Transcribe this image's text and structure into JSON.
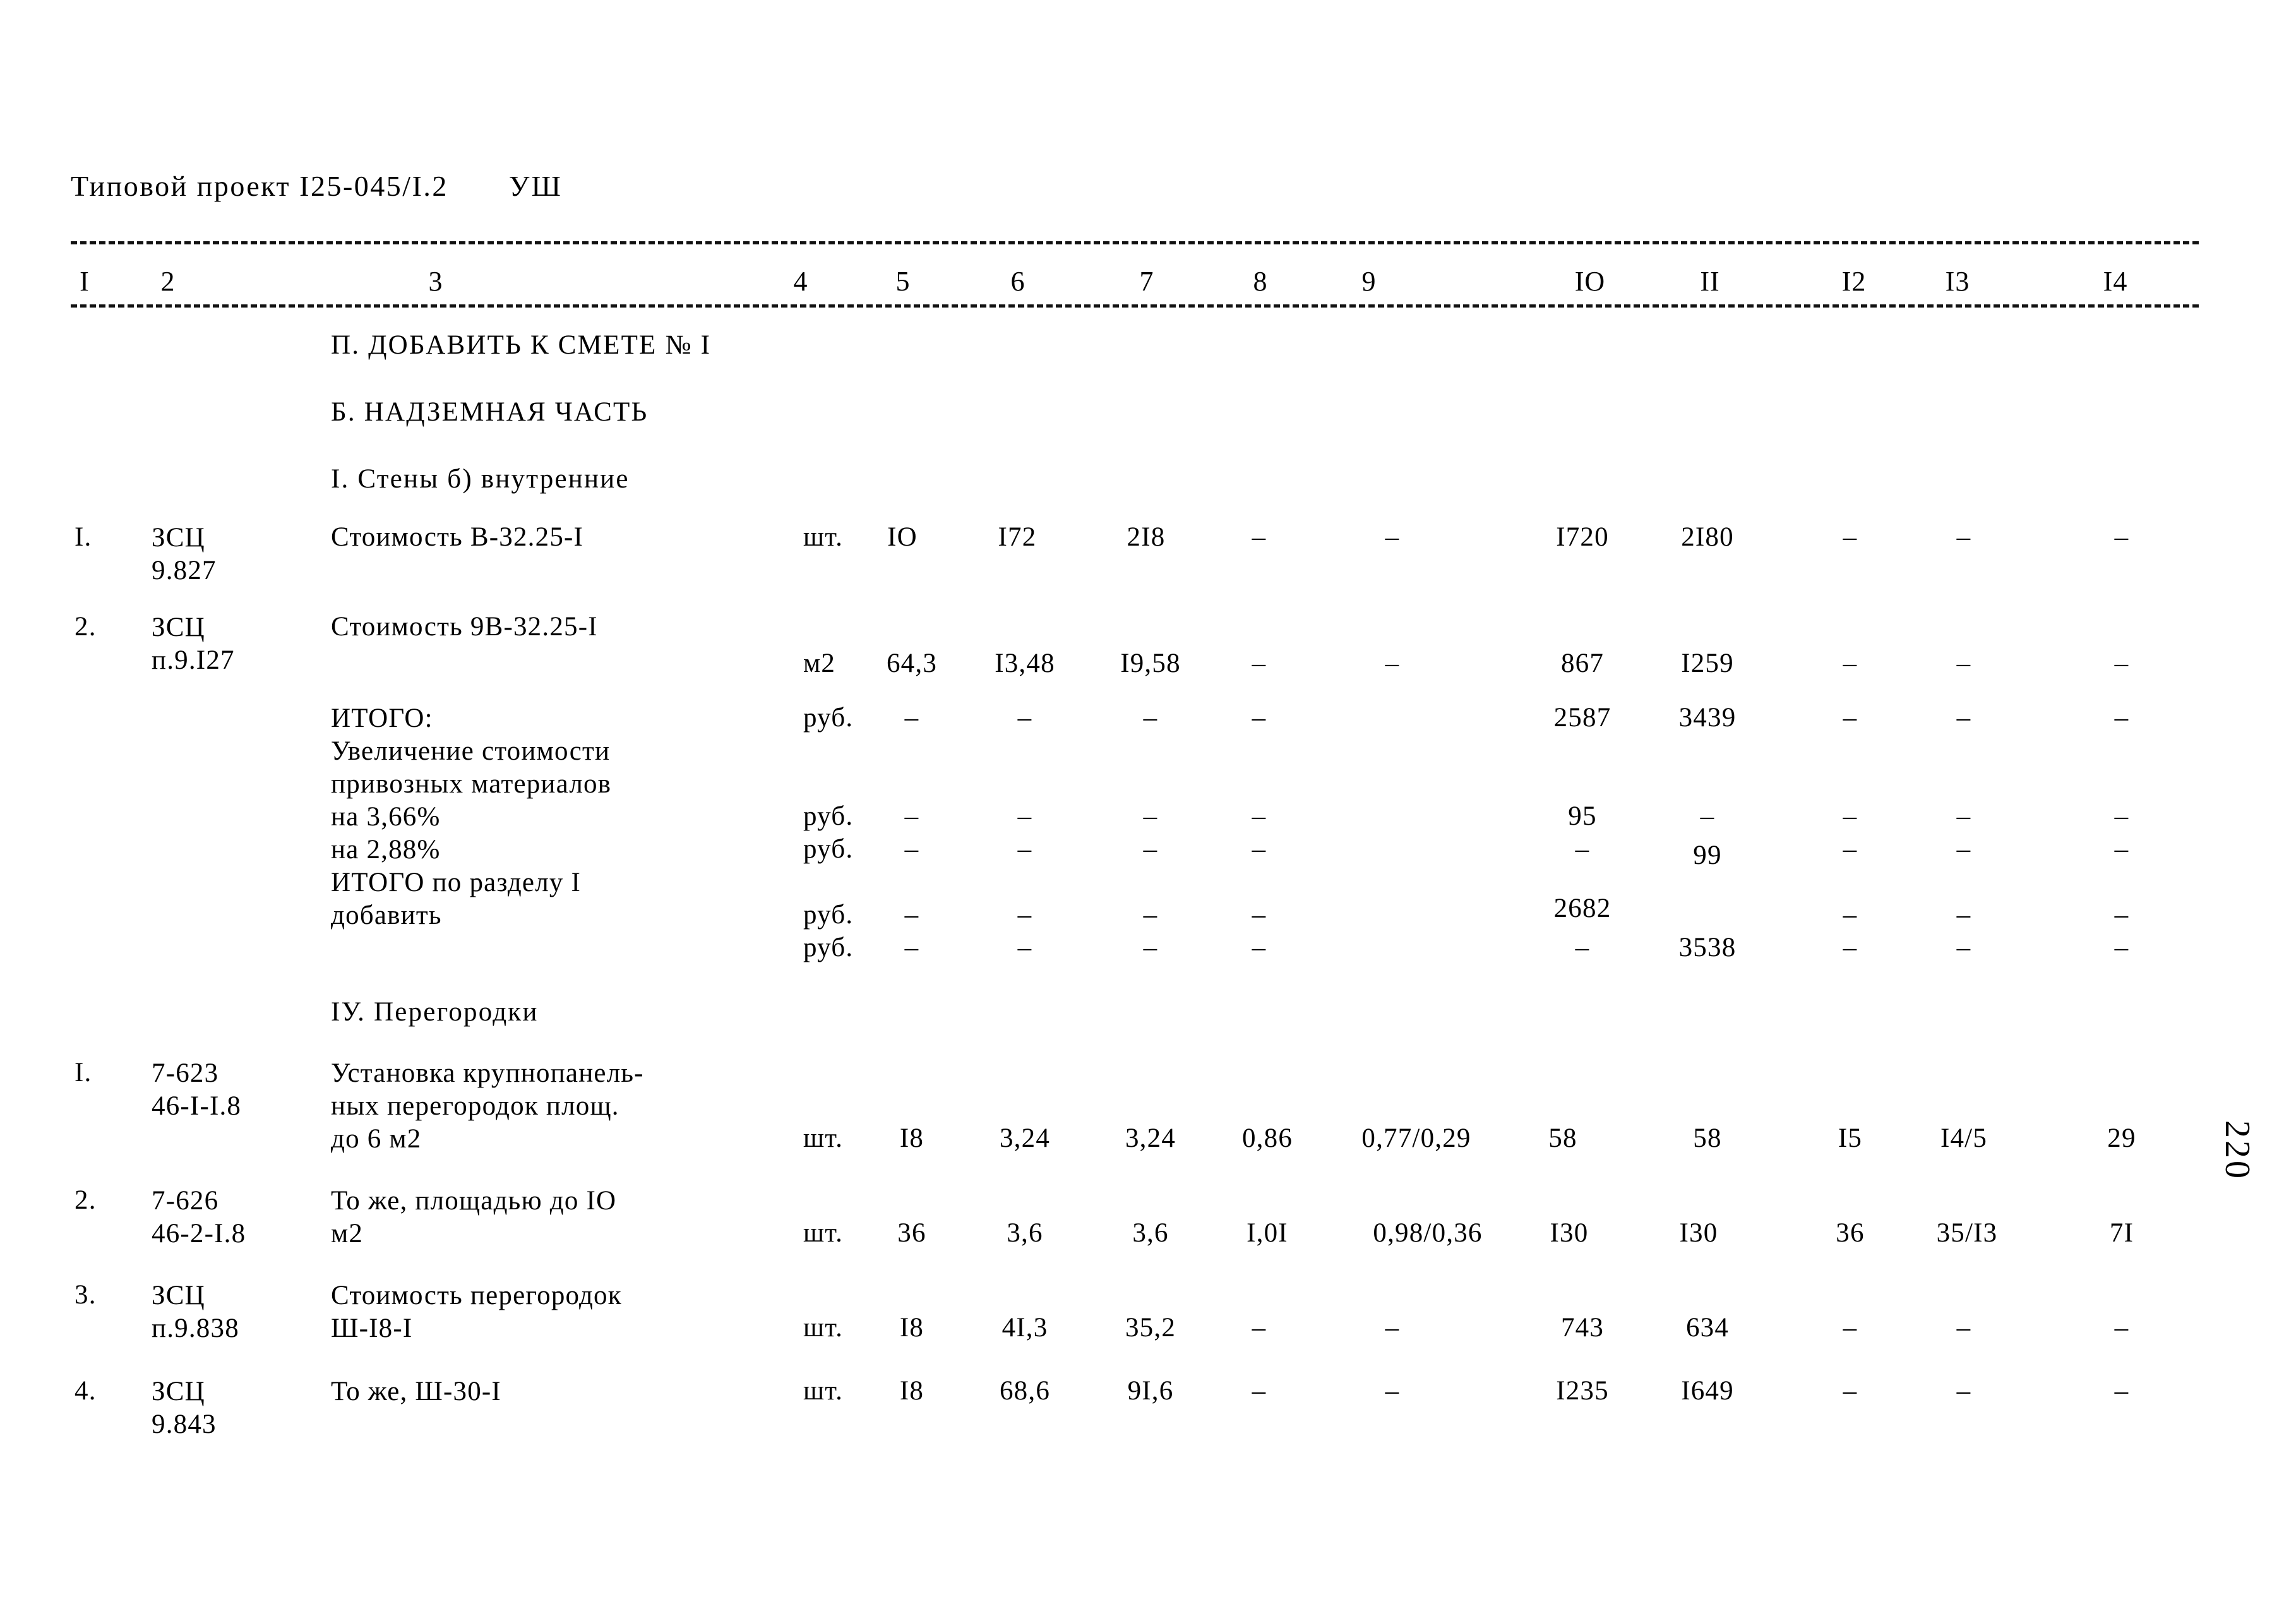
{
  "document": {
    "title_prefix": "Типовой проект",
    "project_code": "I25-045/I.2",
    "sheet_mark": "УШ",
    "folio_number": "220"
  },
  "table": {
    "column_numbers": [
      "I",
      "2",
      "3",
      "4",
      "5",
      "6",
      "7",
      "8",
      "9",
      "IO",
      "II",
      "I2",
      "I3",
      "I4"
    ],
    "sections": [
      {
        "id": "sec-add",
        "label": "П. ДОБАВИТЬ К СМЕТЕ № I"
      },
      {
        "id": "sec-above",
        "label": "Б. НАДЗЕМНАЯ ЧАСТЬ"
      },
      {
        "id": "sec-walls",
        "label": "I. Стены б) внутренние"
      },
      {
        "id": "sec-partitions",
        "label": "IУ. Перегородки"
      }
    ],
    "rows": [
      {
        "no": "I.",
        "code_line1": "ЗСЦ",
        "code_line2": "9.827",
        "desc_line1": "Стоимость В-32.25-I",
        "desc_line2": "",
        "desc_line3": "",
        "unit": "шт.",
        "c5": "IO",
        "c6": "I72",
        "c7": "2I8",
        "c8": "–",
        "c9": "–",
        "c10": "I720",
        "c11": "2I80",
        "c12": "–",
        "c13": "–",
        "c14": "–"
      },
      {
        "no": "2.",
        "code_line1": "ЗСЦ",
        "code_line2": "п.9.I27",
        "desc_line1": "Стоимость 9В-32.25-I",
        "desc_line2": "",
        "desc_line3": "",
        "unit": "м2",
        "c5": "64,3",
        "c6": "I3,48",
        "c7": "I9,58",
        "c8": "–",
        "c9": "–",
        "c10": "867",
        "c11": "I259",
        "c12": "–",
        "c13": "–",
        "c14": "–"
      },
      {
        "no": "",
        "code_line1": "",
        "code_line2": "",
        "desc_line1": "ИТОГО:",
        "desc_line2": "Увеличение стоимости",
        "desc_line3": "привозных материалов",
        "unit": "руб.",
        "c5": "–",
        "c6": "–",
        "c7": "–",
        "c8": "–",
        "c9": "",
        "c10": "2587",
        "c11": "3439",
        "c12": "–",
        "c13": "–",
        "c14": "–"
      },
      {
        "no": "",
        "code_line1": "",
        "code_line2": "",
        "desc_line1": "на 3,66%",
        "desc_line2": "",
        "desc_line3": "",
        "unit": "руб.",
        "c5": "–",
        "c6": "–",
        "c7": "–",
        "c8": "–",
        "c9": "",
        "c10": "95",
        "c11": "–",
        "c12": "–",
        "c13": "–",
        "c14": "–"
      },
      {
        "no": "",
        "code_line1": "",
        "code_line2": "",
        "desc_line1": "на 2,88%",
        "desc_line2": "",
        "desc_line3": "",
        "unit": "руб.",
        "c5": "–",
        "c6": "–",
        "c7": "–",
        "c8": "–",
        "c9": "",
        "c10": "–",
        "c11": "99",
        "c12": "–",
        "c13": "–",
        "c14": "–"
      },
      {
        "no": "",
        "code_line1": "",
        "code_line2": "",
        "desc_line1": "ИТОГО по разделу I",
        "desc_line2": "добавить",
        "desc_line3": "",
        "unit": "руб.",
        "c5": "–",
        "c6": "–",
        "c7": "–",
        "c8": "–",
        "c9": "",
        "c10": "2682",
        "c11": "",
        "c12": "–",
        "c13": "–",
        "c14": "–"
      },
      {
        "no": "",
        "code_line1": "",
        "code_line2": "",
        "desc_line1": "",
        "desc_line2": "",
        "desc_line3": "",
        "unit": "руб.",
        "c5": "–",
        "c6": "–",
        "c7": "–",
        "c8": "–",
        "c9": "",
        "c10": "–",
        "c11": "3538",
        "c12": "–",
        "c13": "–",
        "c14": "–"
      },
      {
        "no": "I.",
        "code_line1": "7-623",
        "code_line2": "46-I-I.8",
        "desc_line1": "Установка крупнопанель-",
        "desc_line2": "ных перегородок площ.",
        "desc_line3": "до 6 м2",
        "unit": "шт.",
        "c5": "I8",
        "c6": "3,24",
        "c7": "3,24",
        "c8": "0,86",
        "c9": "0,77/0,29",
        "c10": "58",
        "c11": "58",
        "c12": "I5",
        "c13": "I4/5",
        "c14": "29"
      },
      {
        "no": "2.",
        "code_line1": "7-626",
        "code_line2": "46-2-I.8",
        "desc_line1": "То же, площадью до IO",
        "desc_line2": "м2",
        "desc_line3": "",
        "unit": "шт.",
        "c5": "36",
        "c6": "3,6",
        "c7": "3,6",
        "c8": "I,0I",
        "c9": "0,98/0,36",
        "c10": "I30",
        "c11": "I30",
        "c12": "36",
        "c13": "35/I3",
        "c14": "7I"
      },
      {
        "no": "3.",
        "code_line1": "ЗСЦ",
        "code_line2": "п.9.838",
        "desc_line1": "Стоимость перегородок",
        "desc_line2": "Ш-I8-I",
        "desc_line3": "",
        "unit": "шт.",
        "c5": "I8",
        "c6": "4I,3",
        "c7": "35,2",
        "c8": "–",
        "c9": "–",
        "c10": "743",
        "c11": "634",
        "c12": "–",
        "c13": "–",
        "c14": "–"
      },
      {
        "no": "4.",
        "code_line1": "ЗСЦ",
        "code_line2": "9.843",
        "desc_line1": "То же, Ш-30-I",
        "desc_line2": "",
        "desc_line3": "",
        "unit": "шт.",
        "c5": "I8",
        "c6": "68,6",
        "c7": "9I,6",
        "c8": "–",
        "c9": "–",
        "c10": "I235",
        "c11": "I649",
        "c12": "–",
        "c13": "–",
        "c14": "–"
      }
    ]
  }
}
